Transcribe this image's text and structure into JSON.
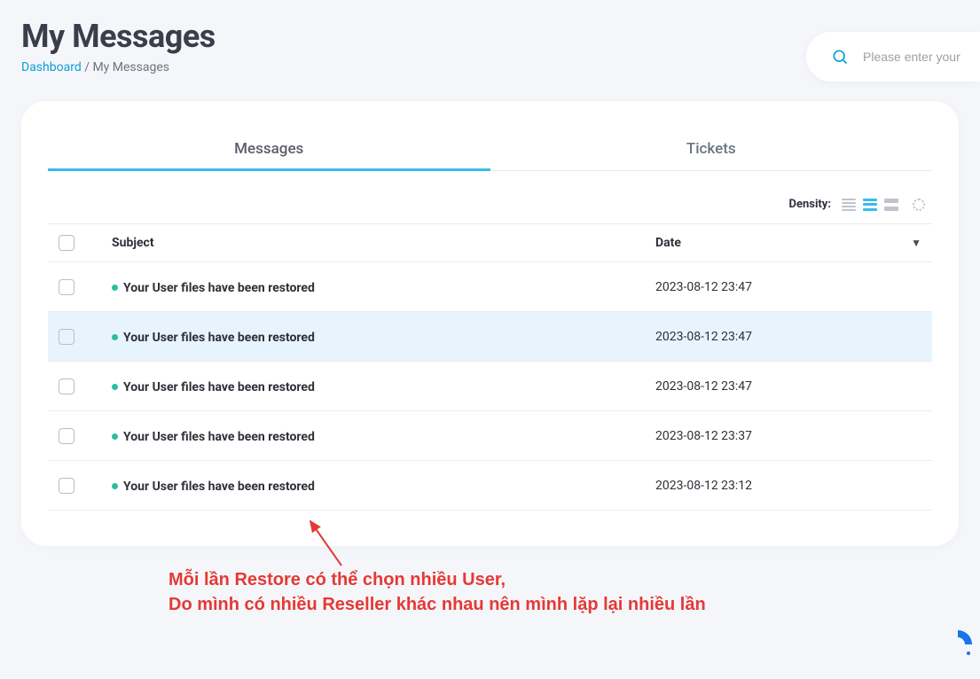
{
  "page": {
    "title": "My Messages"
  },
  "breadcrumb": {
    "dashboard_label": "Dashboard",
    "separator": " / ",
    "current": "My Messages"
  },
  "search": {
    "placeholder": "Please enter your"
  },
  "tabs": {
    "messages": "Messages",
    "tickets": "Tickets"
  },
  "density": {
    "label": "Density:"
  },
  "table": {
    "headers": {
      "subject": "Subject",
      "date": "Date"
    },
    "rows": [
      {
        "subject": "Your User files have been restored",
        "date": "2023-08-12 23:47",
        "highlighted": false
      },
      {
        "subject": "Your User files have been restored",
        "date": "2023-08-12 23:47",
        "highlighted": true
      },
      {
        "subject": "Your User files have been restored",
        "date": "2023-08-12 23:47",
        "highlighted": false
      },
      {
        "subject": "Your User files have been restored",
        "date": "2023-08-12 23:37",
        "highlighted": false
      },
      {
        "subject": "Your User files have been restored",
        "date": "2023-08-12 23:12",
        "highlighted": false
      }
    ]
  },
  "annotation": {
    "line1": "Mỗi lần Restore có thể chọn nhiều User,",
    "line2": "Do mình có nhiều Reseller khác nhau nên mình lặp lại nhiều lần"
  }
}
